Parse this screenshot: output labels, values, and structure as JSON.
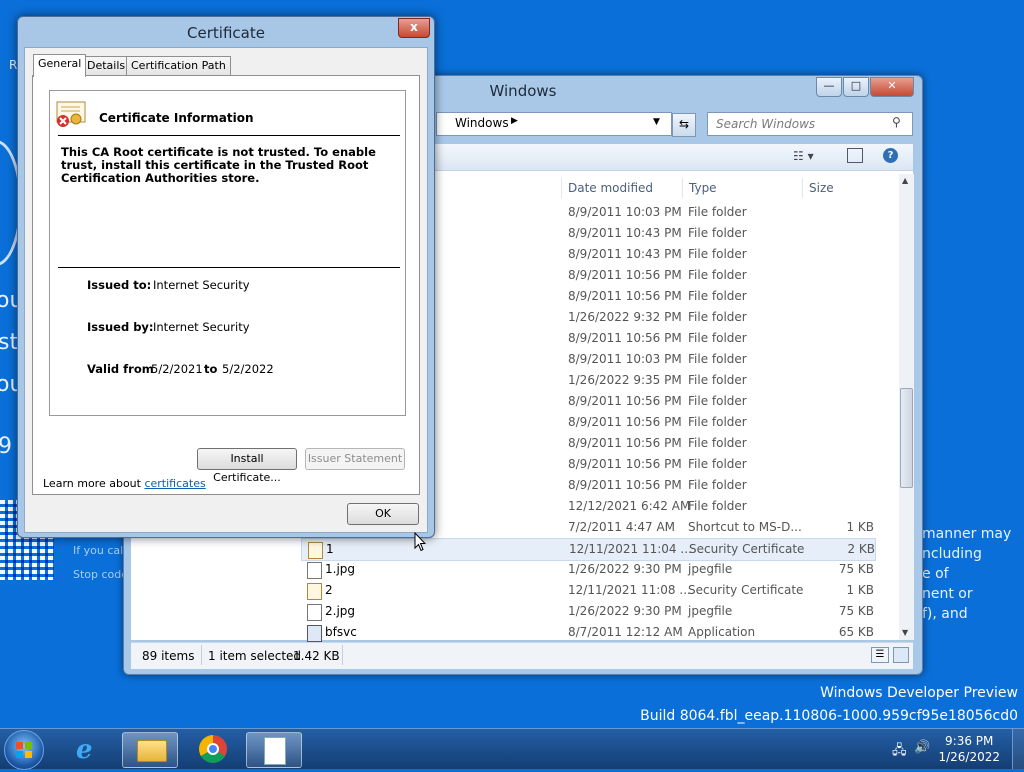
{
  "desktop": {
    "build_line1": "Windows Developer Preview",
    "build_line2": "Build 8064.fbl_eeap.110806-1000.959cf95e18056cd0",
    "bsod_left": [
      "ou",
      "st",
      "ou",
      "9"
    ],
    "bsod_right": [
      "manner may",
      "ncluding",
      "e of",
      "nent or",
      "f), and"
    ],
    "bsod_small1": "If you call",
    "bsod_small2": "Stop code",
    "r_letter": "R"
  },
  "explorer": {
    "title": "Windows",
    "address_segment": "Windows",
    "search_placeholder": "Search Windows",
    "columns": {
      "date": "Date modified",
      "type": "Type",
      "size": "Size"
    },
    "rows": [
      {
        "name": "",
        "date": "8/9/2011 10:03 PM",
        "type": "File folder",
        "size": ""
      },
      {
        "name": "",
        "date": "8/9/2011 10:43 PM",
        "type": "File folder",
        "size": ""
      },
      {
        "name": "",
        "date": "8/9/2011 10:43 PM",
        "type": "File folder",
        "size": ""
      },
      {
        "name": "",
        "date": "8/9/2011 10:56 PM",
        "type": "File folder",
        "size": ""
      },
      {
        "name": "",
        "date": "8/9/2011 10:56 PM",
        "type": "File folder",
        "size": ""
      },
      {
        "name": "",
        "date": "1/26/2022 9:32 PM",
        "type": "File folder",
        "size": ""
      },
      {
        "name": "",
        "date": "8/9/2011 10:56 PM",
        "type": "File folder",
        "size": ""
      },
      {
        "name": "",
        "date": "8/9/2011 10:03 PM",
        "type": "File folder",
        "size": ""
      },
      {
        "name": "",
        "date": "1/26/2022 9:35 PM",
        "type": "File folder",
        "size": ""
      },
      {
        "name": "",
        "date": "8/9/2011 10:56 PM",
        "type": "File folder",
        "size": ""
      },
      {
        "name": "",
        "date": "8/9/2011 10:56 PM",
        "type": "File folder",
        "size": ""
      },
      {
        "name": "",
        "date": "8/9/2011 10:56 PM",
        "type": "File folder",
        "size": ""
      },
      {
        "name": "",
        "date": "8/9/2011 10:56 PM",
        "type": "File folder",
        "size": ""
      },
      {
        "name": "",
        "date": "8/9/2011 10:56 PM",
        "type": "File folder",
        "size": ""
      },
      {
        "name": "",
        "date": "12/12/2021 6:42 AM",
        "type": "File folder",
        "size": ""
      },
      {
        "name": "",
        "date": "7/2/2011 4:47 AM",
        "type": "Shortcut to MS-D...",
        "size": "1 KB"
      },
      {
        "name": "1",
        "date": "12/11/2021 11:04 ...",
        "type": "Security Certificate",
        "size": "2 KB",
        "icon": "cert",
        "selected": true
      },
      {
        "name": "1.jpg",
        "date": "1/26/2022 9:30 PM",
        "type": "jpegfile",
        "size": "75 KB",
        "icon": "file"
      },
      {
        "name": "2",
        "date": "12/11/2021 11:08 ...",
        "type": "Security Certificate",
        "size": "1 KB",
        "icon": "cert"
      },
      {
        "name": "2.jpg",
        "date": "1/26/2022 9:30 PM",
        "type": "jpegfile",
        "size": "75 KB",
        "icon": "file"
      },
      {
        "name": "bfsvc",
        "date": "8/7/2011 12:12 AM",
        "type": "Application",
        "size": "65 KB",
        "icon": "app"
      }
    ],
    "status_items": "89 items",
    "status_selected": "1 item selected",
    "status_size": "1.42 KB"
  },
  "certificate": {
    "title": "Certificate",
    "close_glyph": "x",
    "tabs": [
      "General",
      "Details",
      "Certification Path"
    ],
    "info_heading": "Certificate Information",
    "warning": "This CA Root certificate is not trusted. To enable trust, install this certificate in the Trusted Root Certification Authorities store.",
    "issued_to_label": "Issued to:",
    "issued_to": "Internet Security",
    "issued_by_label": "Issued by:",
    "issued_by": "Internet Security",
    "valid_from_label": "Valid from",
    "valid_from": "5/2/2021",
    "to_label": "to",
    "valid_to": "5/2/2022",
    "install_button": "Install Certificate...",
    "issuer_button": "Issuer Statement",
    "learn_more": "Learn more about",
    "learn_link": "certificates",
    "ok_button": "OK"
  },
  "taskbar": {
    "time": "9:36 PM",
    "date": "1/26/2022"
  },
  "colors": {
    "desktop": "#0a6fd8",
    "link": "#0b5fb3"
  }
}
